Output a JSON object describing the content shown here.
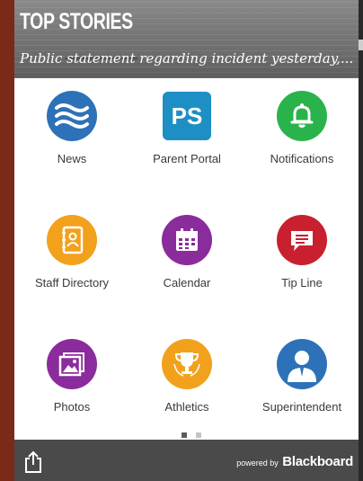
{
  "banner": {
    "title": "TOP STORIES",
    "headline": "Public statement regarding incident yesterday,..."
  },
  "tiles": [
    {
      "label": "News",
      "icon": "waves-icon",
      "color": "#2d72b8"
    },
    {
      "label": "Parent Portal",
      "icon": "ps-logo-icon",
      "color": "#1e8fc4",
      "icon_text": "PS"
    },
    {
      "label": "Notifications",
      "icon": "bell-icon",
      "color": "#2bb34b"
    },
    {
      "label": "Staff Directory",
      "icon": "address-book-icon",
      "color": "#f2a11d"
    },
    {
      "label": "Calendar",
      "icon": "calendar-icon",
      "color": "#8b2c9c"
    },
    {
      "label": "Tip Line",
      "icon": "chat-bubble-icon",
      "color": "#c8202f"
    },
    {
      "label": "Photos",
      "icon": "photo-icon",
      "color": "#8b2c9c"
    },
    {
      "label": "Athletics",
      "icon": "trophy-icon",
      "color": "#f2a11d"
    },
    {
      "label": "Superintendent",
      "icon": "person-icon",
      "color": "#2d72b8"
    }
  ],
  "pager": {
    "pages": 2,
    "active": 1
  },
  "footer": {
    "powered_by": "powered by",
    "brand": "Blackboard",
    "share_icon": "share-icon"
  }
}
